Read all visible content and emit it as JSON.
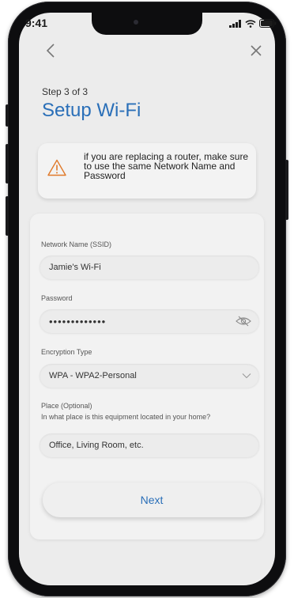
{
  "status_bar": {
    "time": "9:41"
  },
  "nav": {
    "back_icon": "chevron-left-icon",
    "close_icon": "close-icon"
  },
  "header": {
    "step": "Step 3 of 3",
    "title": "Setup Wi-Fi"
  },
  "warning": {
    "icon": "warning-triangle-icon",
    "text": "if you are replacing a router, make sure to use the same Network Name and Password",
    "icon_color": "#e07a2b"
  },
  "form": {
    "network_name": {
      "label": "Network Name (SSID)",
      "value": "Jamie's Wi-Fi"
    },
    "password": {
      "label": "Password",
      "value": "•••••••••••••",
      "toggle_icon": "eye-slash-icon"
    },
    "encryption": {
      "label": "Encryption Type",
      "value": "WPA - WPA2-Personal",
      "dropdown_icon": "chevron-down-icon"
    },
    "place": {
      "label": "Place (Optional)",
      "helper": "In what place is this equipment located in your home?",
      "placeholder": "Office, Living Room, etc."
    }
  },
  "actions": {
    "next_label": "Next"
  },
  "colors": {
    "accent": "#2a6fb8",
    "background": "#ececec"
  }
}
